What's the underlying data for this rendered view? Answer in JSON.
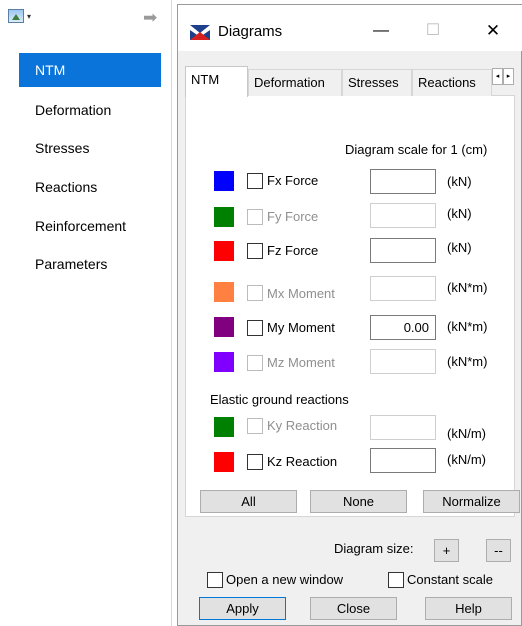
{
  "left_panel": {
    "items": [
      {
        "label": "NTM",
        "active": true
      },
      {
        "label": "Deformation"
      },
      {
        "label": "Stresses"
      },
      {
        "label": "Reactions"
      },
      {
        "label": "Reinforcement"
      },
      {
        "label": "Parameters"
      }
    ],
    "toolbar": {
      "view_icon": "view-icon",
      "dropdown_caret": "▾",
      "arrow": "➡"
    }
  },
  "dialog": {
    "title": "Diagrams",
    "titlebar": {
      "minimize": "—",
      "maximize": "☐",
      "close": "✕"
    },
    "tabs": [
      "NTM",
      "Deformation",
      "Stresses",
      "Reactions"
    ],
    "tab_scroll": {
      "left": "◂",
      "right": "▸"
    },
    "scale_header": "Diagram scale for 1  (cm)",
    "rows": [
      {
        "label": "Fx Force",
        "color": "#0000ff",
        "enabled": true,
        "value": "",
        "unit": "(kN)"
      },
      {
        "label": "Fy Force",
        "color": "#008000",
        "enabled": false,
        "value": "",
        "unit": "(kN)"
      },
      {
        "label": "Fz Force",
        "color": "#ff0000",
        "enabled": true,
        "value": "",
        "unit": "(kN)"
      },
      {
        "label": "Mx Moment",
        "color": "#ff8040",
        "enabled": false,
        "value": "",
        "unit": "(kN*m)"
      },
      {
        "label": "My Moment",
        "color": "#800080",
        "enabled": true,
        "value": "0.00",
        "unit": "(kN*m)"
      },
      {
        "label": "Mz Moment",
        "color": "#8000ff",
        "enabled": false,
        "value": "",
        "unit": "(kN*m)"
      }
    ],
    "elastic_title": "Elastic ground reactions",
    "elastic_rows": [
      {
        "label": "Ky Reaction",
        "color": "#008000",
        "enabled": false,
        "value": "",
        "unit": "(kN/m)"
      },
      {
        "label": "Kz Reaction",
        "color": "#ff0000",
        "enabled": true,
        "value": "",
        "unit": "(kN/m)"
      }
    ],
    "buttons": {
      "all": "All",
      "none": "None",
      "normalize": "Normalize"
    },
    "diagram_size": {
      "label": "Diagram size:",
      "plus": "+",
      "minus": "--"
    },
    "options": {
      "open_new_window": "Open a new window",
      "constant_scale": "Constant scale"
    },
    "footer": {
      "apply": "Apply",
      "close": "Close",
      "help": "Help"
    }
  }
}
